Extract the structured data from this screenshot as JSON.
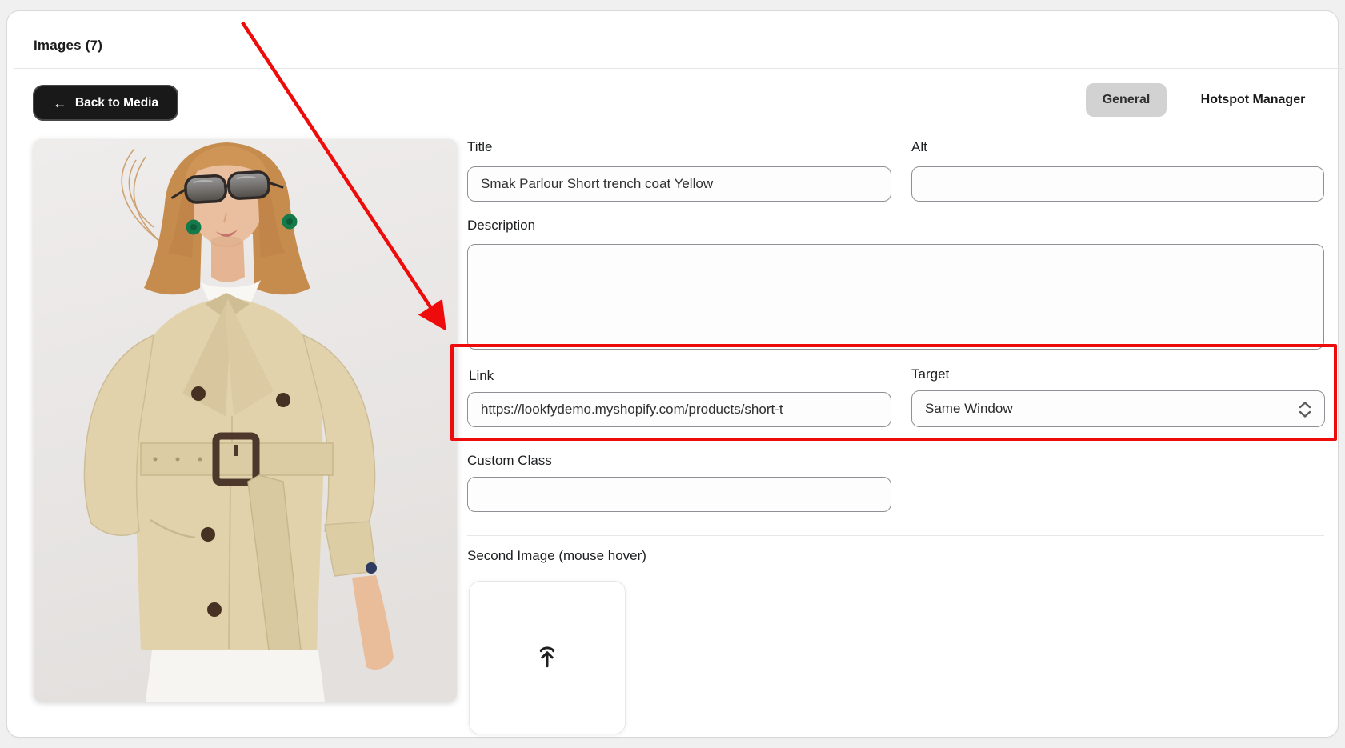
{
  "header": {
    "title": "Images (7)"
  },
  "toolbar": {
    "back_label": "Back to Media",
    "back_arrow": "←"
  },
  "tabs": [
    {
      "label": "General",
      "active": true
    },
    {
      "label": "Hotspot Manager",
      "active": false
    }
  ],
  "product_image": {
    "description": "Model with dark sunglasses and green earrings wearing a beige belted short trench coat over white clothing"
  },
  "form": {
    "title": {
      "label": "Title",
      "value": "Smak Parlour Short trench coat Yellow"
    },
    "alt": {
      "label": "Alt",
      "value": ""
    },
    "description": {
      "label": "Description",
      "value": ""
    },
    "link": {
      "label": "Link",
      "value": "https://lookfydemo.myshopify.com/products/short-t"
    },
    "target": {
      "label": "Target",
      "value": "Same Window"
    },
    "custom_class": {
      "label": "Custom Class",
      "value": ""
    },
    "second_image": {
      "label": "Second Image (mouse hover)"
    }
  },
  "annotation": {
    "color": "#ee0b0b"
  },
  "colors": {
    "accent_red": "#ee0b0b",
    "active_tab_bg": "#d2d2d2",
    "button_bg": "#191919",
    "panel_bg": "#ffffff",
    "page_bg": "#f0f0f1"
  }
}
